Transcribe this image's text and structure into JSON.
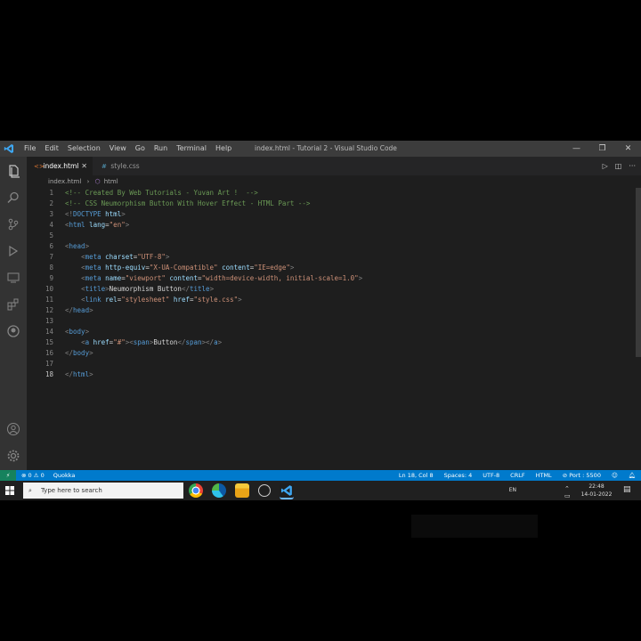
{
  "window": {
    "title": "index.html - Tutorial 2 - Visual Studio Code",
    "menu": [
      "File",
      "Edit",
      "Selection",
      "View",
      "Go",
      "Run",
      "Terminal",
      "Help"
    ],
    "controls": {
      "minimize": "—",
      "maximize": "❐",
      "close": "✕"
    }
  },
  "tabs": [
    {
      "label": "index.html",
      "icon": "html-file-icon",
      "active": true,
      "close": "✕"
    },
    {
      "label": "style.css",
      "icon": "css-file-icon",
      "active": false
    }
  ],
  "breadcrumb": {
    "file": "index.html",
    "separator": "›",
    "element": "html"
  },
  "editor": {
    "line_numbers": [
      "1",
      "2",
      "3",
      "4",
      "5",
      "6",
      "7",
      "8",
      "9",
      "10",
      "11",
      "12",
      "13",
      "14",
      "15",
      "16",
      "17",
      "18"
    ],
    "lines": [
      "<!-- Created By Web Tutorials - Yuvan Art !  -->",
      "<!-- CSS Neumorphism Button With Hover Effect - HTML Part -->",
      "<!DOCTYPE html>",
      "<html lang=\"en\">",
      "",
      "<head>",
      "    <meta charset=\"UTF-8\">",
      "    <meta http-equiv=\"X-UA-Compatible\" content=\"IE=edge\">",
      "    <meta name=\"viewport\" content=\"width=device-width, initial-scale=1.0\">",
      "    <title>Neumorphism Button</title>",
      "    <link rel=\"stylesheet\" href=\"style.css\">",
      "</head>",
      "",
      "<body>",
      "    <a href=\"#\"><span>Button</span></a>",
      "</body>",
      "",
      "</html>"
    ]
  },
  "statusbar": {
    "remote": "⚡",
    "problems": "⊗ 0  ⚠ 0",
    "quokka": "Quokka",
    "position": "Ln 18, Col 8",
    "spaces": "Spaces: 4",
    "encoding": "UTF-8",
    "eol": "CRLF",
    "language": "HTML",
    "port": "⊘ Port : 5500"
  },
  "taskbar": {
    "search_placeholder": "Type here to search",
    "lang": "EN",
    "time": "22:48",
    "date": "14-01-2022",
    "apps": [
      "chrome-icon",
      "edge-icon",
      "file-explorer-icon",
      "settings-icon",
      "vscode-icon"
    ]
  },
  "colors": {
    "accent": "#007acc",
    "titlebar": "#3c3c3c",
    "activitybar": "#333333",
    "editor_bg": "#1e1e1e"
  }
}
